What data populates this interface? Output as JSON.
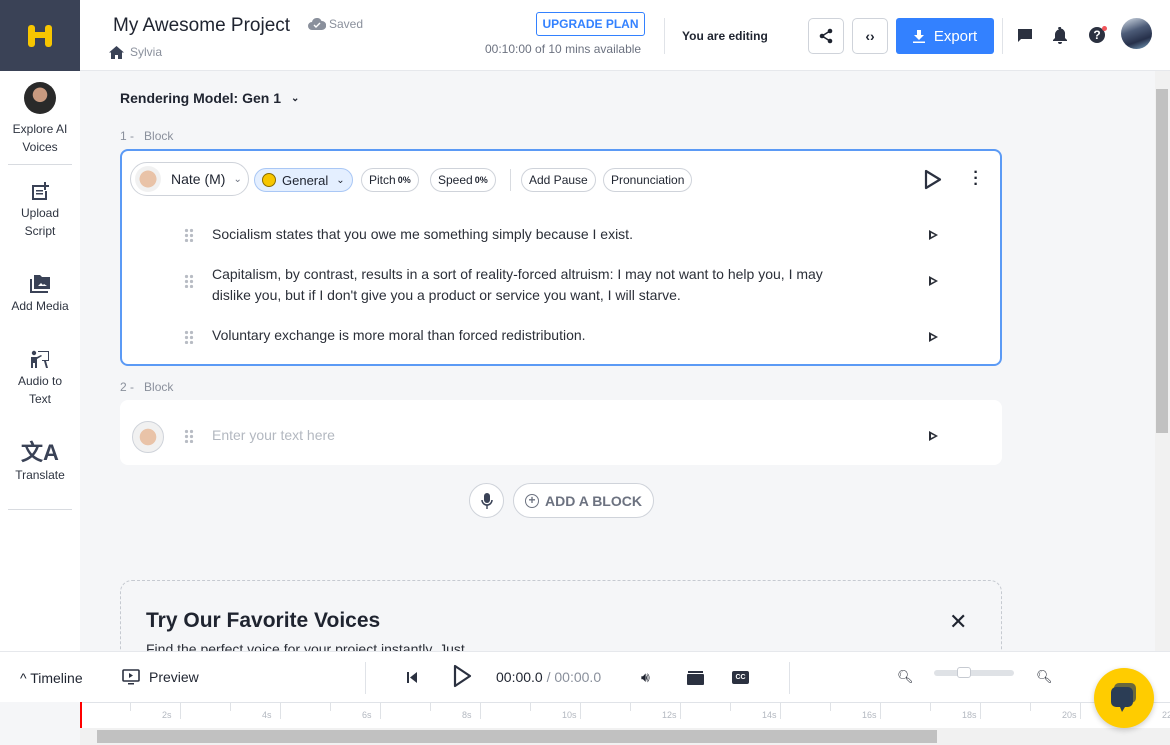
{
  "header": {
    "project_title": "My Awesome Project",
    "save_status": "Saved",
    "workspace": "Sylvia",
    "upgrade_label": "UPGRADE PLAN",
    "usage": "00:10:00 of 10 mins available",
    "editing_status": "You are editing",
    "export_label": "Export"
  },
  "sidebar": {
    "items": [
      {
        "label": "Explore AI Voices",
        "icon": "avatar"
      },
      {
        "label": "Upload Script",
        "icon": "note-add-icon"
      },
      {
        "label": "Add Media",
        "icon": "folder-media-icon"
      },
      {
        "label": "Audio to Text",
        "icon": "presenter-icon"
      },
      {
        "label": "Translate",
        "icon": "translate-icon"
      }
    ]
  },
  "main": {
    "rendering_model": "Rendering Model: Gen 1",
    "blocks": [
      {
        "label": "1 -",
        "name": "Block",
        "voice": "Nate (M)",
        "style": "General",
        "pitch_label": "Pitch",
        "pitch": "0%",
        "speed_label": "Speed",
        "speed": "0%",
        "add_pause": "Add Pause",
        "pronunciation": "Pronunciation",
        "sentences": [
          "Socialism states that you owe me something simply because I exist.",
          "Capitalism, by contrast, results in a sort of reality-forced altruism: I may not want to help you, I may dislike you, but if I don't give you a product or service you want, I will starve.",
          "Voluntary exchange is more moral than forced redistribution."
        ]
      },
      {
        "label": "2 -",
        "name": "Block",
        "placeholder": "Enter your text here"
      }
    ],
    "add_block_label": "ADD A BLOCK",
    "favorites": {
      "title": "Try Our Favorite Voices",
      "subtitle": "Find the perfect voice for your project instantly. Just"
    }
  },
  "player": {
    "timeline_label": "Timeline",
    "preview_label": "Preview",
    "current_time": "00:00.0",
    "total_time": "/ 00:00.0",
    "zoom_level": 0.35
  },
  "ruler": {
    "labels": [
      "2s",
      "4s",
      "6s",
      "8s",
      "10s",
      "12s",
      "14s",
      "16s",
      "18s",
      "20s",
      "22"
    ]
  },
  "colors": {
    "accent": "#3381ff",
    "sidebar_logo_bg": "#3a4256",
    "logo": "#f7c600",
    "chat_bubble": "#ffcc00"
  }
}
